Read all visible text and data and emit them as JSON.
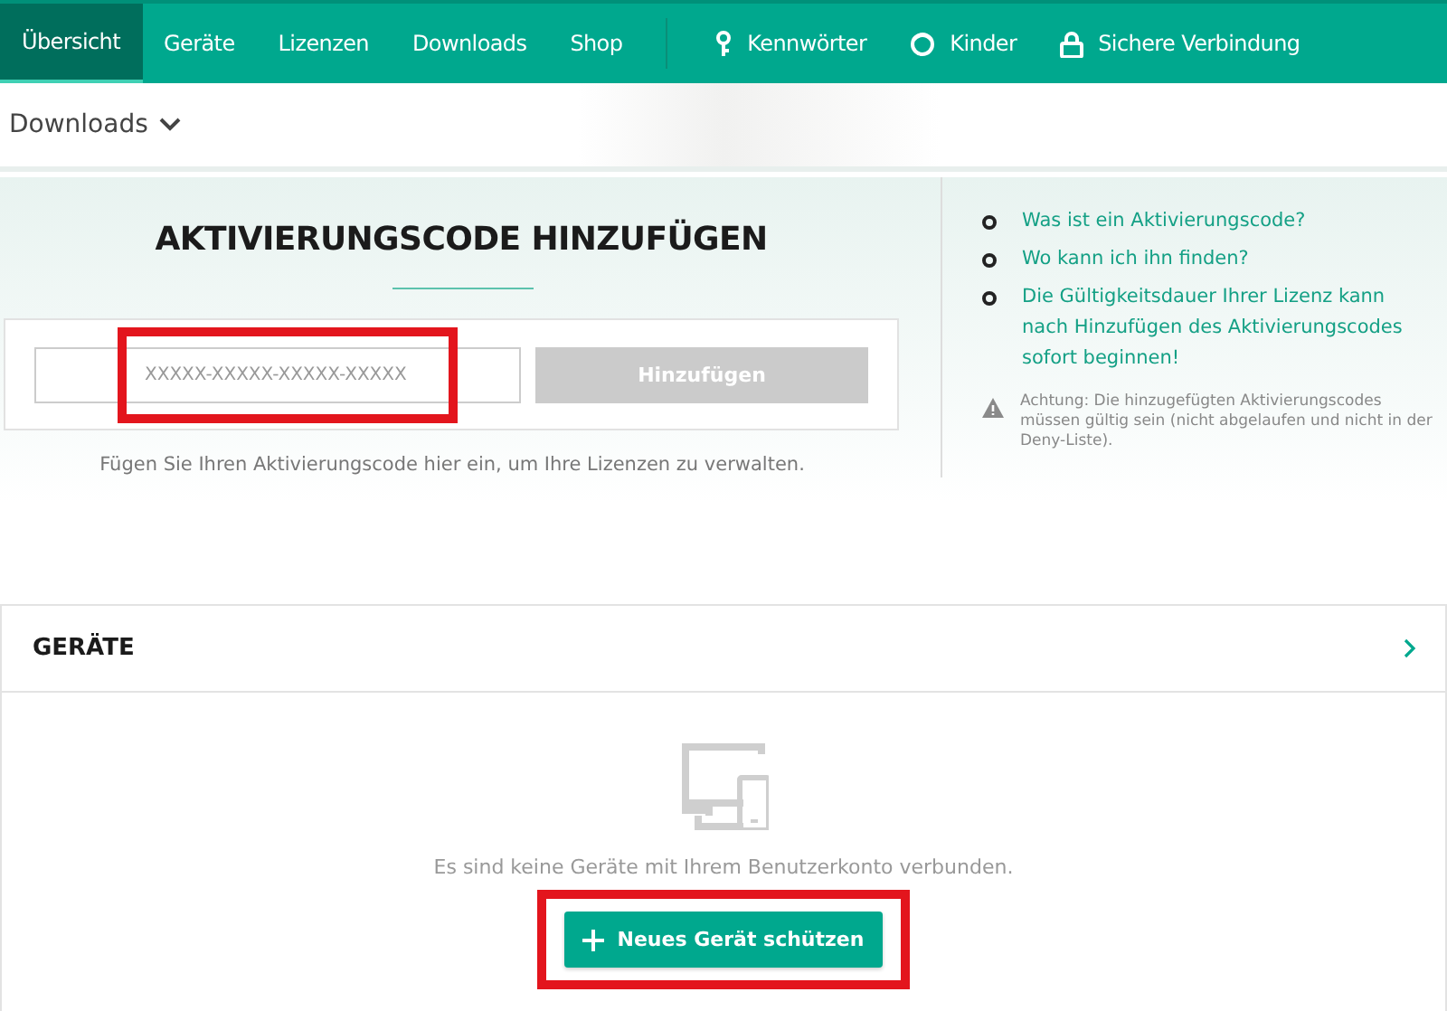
{
  "nav": {
    "tabs": [
      {
        "label": "Übersicht",
        "selected": true
      },
      {
        "label": "Geräte",
        "selected": false
      },
      {
        "label": "Lizenzen",
        "selected": false
      },
      {
        "label": "Downloads",
        "selected": false
      },
      {
        "label": "Shop",
        "selected": false
      }
    ],
    "tools": [
      {
        "label": "Kennwörter",
        "kind": "key"
      },
      {
        "label": "Kinder",
        "kind": "child"
      },
      {
        "label": "Sichere Verbindung",
        "kind": "lock"
      }
    ]
  },
  "subbar": {
    "label": "Downloads"
  },
  "activation": {
    "title": "AKTIVIERUNGSCODE HINZUFÜGEN",
    "field": {
      "placeholder": "XXXXX-XXXXX-XXXXX-XXXXX"
    },
    "button": {
      "label": "Hinzufügen",
      "disabled": true
    },
    "hint": "Fügen Sie Ihren Aktivierungscode hier ein, um Ihre Lizenzen zu verwalten.",
    "links": [
      "Was ist ein Aktivierungscode?",
      "Wo kann ich ihn finden?",
      "Die Gültigkeitsdauer Ihrer Lizenz kann nach Hinzufügen des Aktivierungscodes sofort beginnen!"
    ],
    "warning": "Achtung: Die hinzugefügten Aktivierungscodes müssen gültig sein (nicht abgelaufen und nicht in der Deny-Liste)."
  },
  "devices": {
    "title": "GERÄTE",
    "empty_text": "Es sind keine Geräte mit Ihrem Benutzerkonto verbunden.",
    "button": {
      "label": "Neues Gerät schützen"
    }
  }
}
